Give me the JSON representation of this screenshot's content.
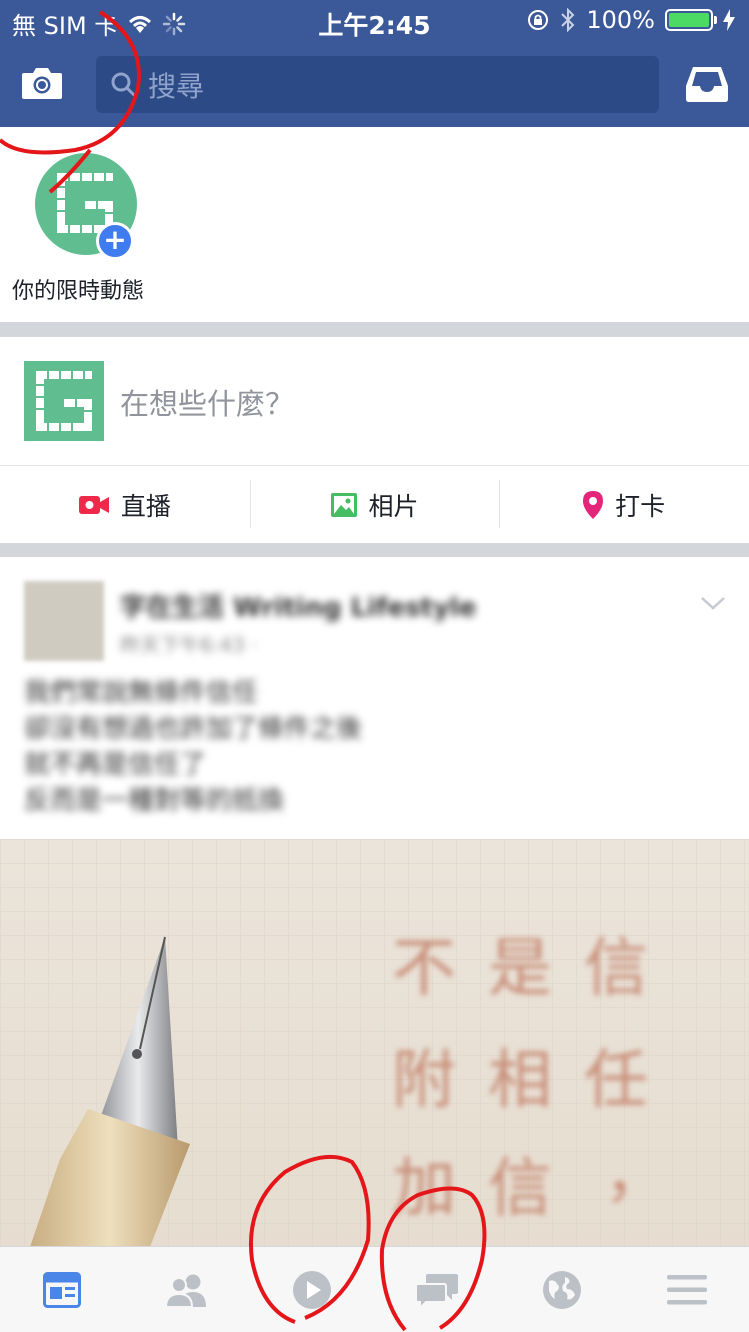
{
  "status_bar": {
    "carrier": "無 SIM 卡",
    "time": "上午2:45",
    "battery": "100%",
    "battery_level": 1.0
  },
  "header": {
    "search_placeholder": "搜尋",
    "left_icon": "camera-icon",
    "right_icon": "inbox-icon"
  },
  "stories": {
    "own_story_label": "你的限時動態",
    "badge_icon": "plus-icon"
  },
  "composer": {
    "placeholder": "在想些什麼？",
    "actions": [
      {
        "label": "直播",
        "icon": "live-video-icon",
        "color": "#f02849"
      },
      {
        "label": "相片",
        "icon": "photo-icon",
        "color": "#45bd62"
      },
      {
        "label": "打卡",
        "icon": "check-in-icon",
        "color": "#e4267a"
      }
    ]
  },
  "post": {
    "author": "字在生活 Writing Lifestyle",
    "time": "昨天下午6:43 · ",
    "lines": [
      "我們常說無條件信任",
      "卻沒有想過也許加了條件之後",
      "就不再是信任了",
      "反而是一種對等的抵換"
    ],
    "image_text": [
      "不",
      "是",
      "信",
      "附",
      "相",
      "任",
      "加",
      "信",
      "，"
    ]
  },
  "tabbar": {
    "tabs": [
      {
        "name": "news-feed",
        "icon": "news-feed-icon",
        "active": true
      },
      {
        "name": "friends",
        "icon": "friends-icon",
        "active": false
      },
      {
        "name": "video",
        "icon": "video-play-icon",
        "active": false
      },
      {
        "name": "messages",
        "icon": "chat-bubbles-icon",
        "active": false
      },
      {
        "name": "notifications",
        "icon": "globe-icon",
        "active": false
      },
      {
        "name": "menu",
        "icon": "hamburger-menu-icon",
        "active": false
      }
    ]
  },
  "colors": {
    "brand": "#3b5998",
    "search_bg": "#2c4a86",
    "active_tab": "#4a86e8",
    "inactive_tab": "#bcc0c7",
    "annotation": "#e4161a"
  }
}
